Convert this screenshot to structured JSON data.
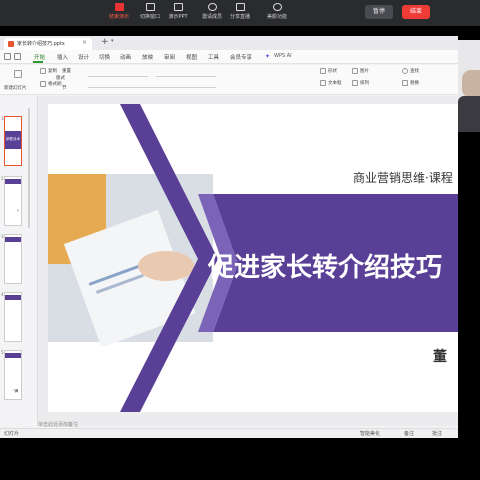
{
  "meeting_toolbar": {
    "tools": [
      {
        "label": "结束演示"
      },
      {
        "label": "切换窗口"
      },
      {
        "label": "演示PPT"
      },
      {
        "label": "邀请成员"
      },
      {
        "label": "分享直播"
      },
      {
        "label": "美颜功能"
      }
    ],
    "pause_label": "暂停",
    "end_label": "结束",
    "accent": "#ee3b36"
  },
  "document_tab": {
    "title": "家长转介绍技巧.pptx"
  },
  "menu": {
    "items": [
      {
        "label": "开始",
        "active": true
      },
      {
        "label": "插入"
      },
      {
        "label": "设计"
      },
      {
        "label": "切换"
      },
      {
        "label": "动画"
      },
      {
        "label": "放映"
      },
      {
        "label": "审阅"
      },
      {
        "label": "视图"
      },
      {
        "label": "工具"
      },
      {
        "label": "会员专享"
      }
    ],
    "ai_label": "WPS AI"
  },
  "ribbon": {
    "labels": [
      "复制",
      "格式刷",
      "新建幻灯片",
      "版式",
      "重置",
      "节",
      "形状",
      "图片",
      "文本框",
      "排列",
      "查找",
      "替换"
    ]
  },
  "thumbnails": {
    "items": [
      {
        "num": "1",
        "text": "销售谈术"
      },
      {
        "num": "2",
        "text": "?"
      },
      {
        "num": "3",
        "text": ""
      },
      {
        "num": "4",
        "text": ""
      },
      {
        "num": "5",
        "text": "\"满"
      }
    ]
  },
  "slide": {
    "subtitle": "商业营销思维·课程",
    "title": "促进家长转介绍技巧",
    "author": "董",
    "band_color": "#5a3f96"
  },
  "notes_placeholder": "单击此处添加备注",
  "status": {
    "left": "幻灯片",
    "center": "智能美化",
    "notes": "备注",
    "comments": "批注"
  }
}
